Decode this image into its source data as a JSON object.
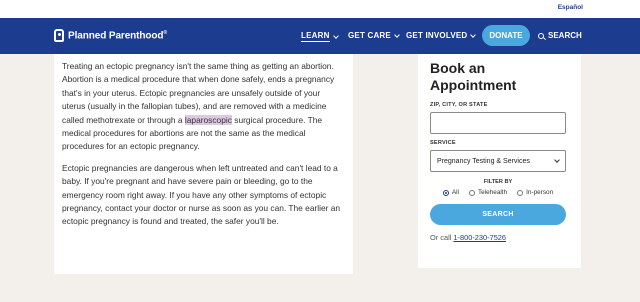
{
  "topbar": {
    "language": "Español"
  },
  "nav": {
    "logo": "Planned Parenthood",
    "logo_mark": "®",
    "items": [
      {
        "label": "LEARN"
      },
      {
        "label": "GET CARE"
      },
      {
        "label": "GET INVOLVED"
      }
    ],
    "donate": "DONATE",
    "search": "SEARCH"
  },
  "article": {
    "p1_before": "Treating an ectopic pregnancy isn't the same thing as getting an abortion. Abortion is a medical procedure that when done safely, ends a pregnancy that's in your uterus. Ectopic pregnancies are unsafely outside of your uterus (usually in the fallopian tubes), and are removed with a medicine called methotrexate or through a ",
    "p1_highlight": "laparoscopic",
    "p1_after": " surgical procedure. The medical procedures for abortions are not the same as the medical procedures for an ectopic pregnancy.",
    "p2": "Ectopic pregnancies are dangerous when left untreated and can't lead to a baby. If you're pregnant and have severe pain or bleeding, go to the emergency room right away. If you have any other symptoms of ectopic pregnancy, contact your doctor or nurse as soon as you can. The earlier an ectopic pregnancy is found and treated, the safer you'll be."
  },
  "booking": {
    "title": "Book an Appointment",
    "zip_label": "ZIP, CITY, OR STATE",
    "zip_value": "",
    "service_label": "SERVICE",
    "service_value": "Pregnancy Testing & Services",
    "filter_label": "FILTER BY",
    "filters": [
      {
        "label": "All",
        "selected": true
      },
      {
        "label": "Telehealth",
        "selected": false
      },
      {
        "label": "In-person",
        "selected": false
      }
    ],
    "search_button": "SEARCH",
    "call_prefix": "Or call",
    "phone": "1-800-230-7526"
  },
  "colors": {
    "nav_bg": "#1c3c8f",
    "accent": "#4aa8df",
    "page_bg": "#f3f0ec",
    "highlight": "#dccbe0"
  }
}
